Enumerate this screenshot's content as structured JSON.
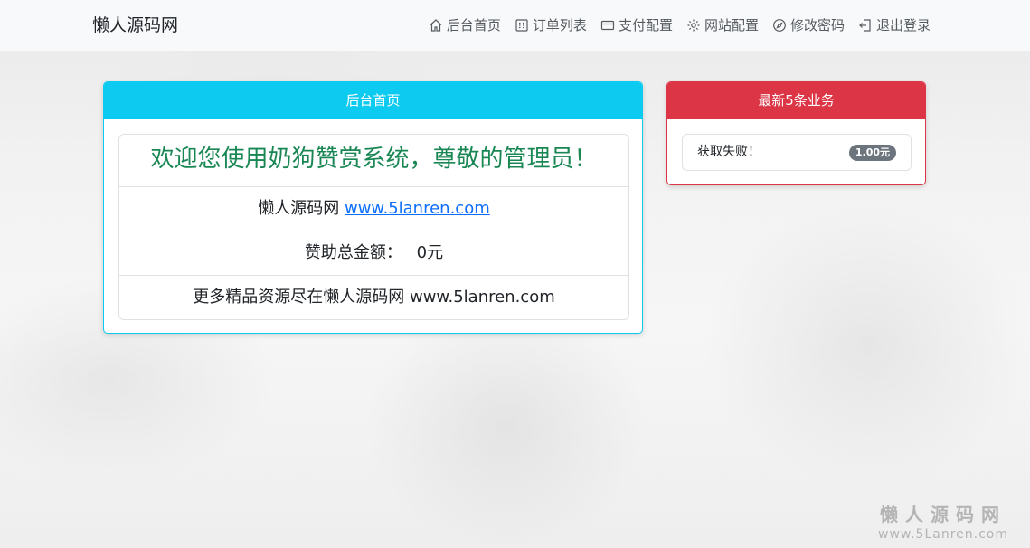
{
  "navbar": {
    "brand": "懒人源码网",
    "links": [
      {
        "label": "后台首页",
        "icon": "home-icon"
      },
      {
        "label": "订单列表",
        "icon": "list-icon"
      },
      {
        "label": "支付配置",
        "icon": "credit-card-icon"
      },
      {
        "label": "网站配置",
        "icon": "gear-icon"
      },
      {
        "label": "修改密码",
        "icon": "compass-icon"
      },
      {
        "label": "退出登录",
        "icon": "logout-icon"
      }
    ]
  },
  "main_card": {
    "title": "后台首页",
    "welcome": "欢迎您使用奶狗赞赏系统，尊敬的管理员！",
    "site_prefix": "懒人源码网 ",
    "site_link": "www.5lanren.com",
    "sponsor_label": "赞助总金额：",
    "sponsor_value": "0元",
    "more_text": "更多精品资源尽在懒人源码网 www.5lanren.com"
  },
  "side_card": {
    "title": "最新5条业务",
    "item_text": "获取失败！",
    "item_badge": "1.00元"
  },
  "watermark": {
    "title": "懒人源码网",
    "url": "www.5Lanren.com"
  },
  "colors": {
    "info": "#0dcaf0",
    "danger": "#dc3545",
    "success_text": "#198754",
    "link": "#0d6efd",
    "badge": "#6c757d"
  }
}
